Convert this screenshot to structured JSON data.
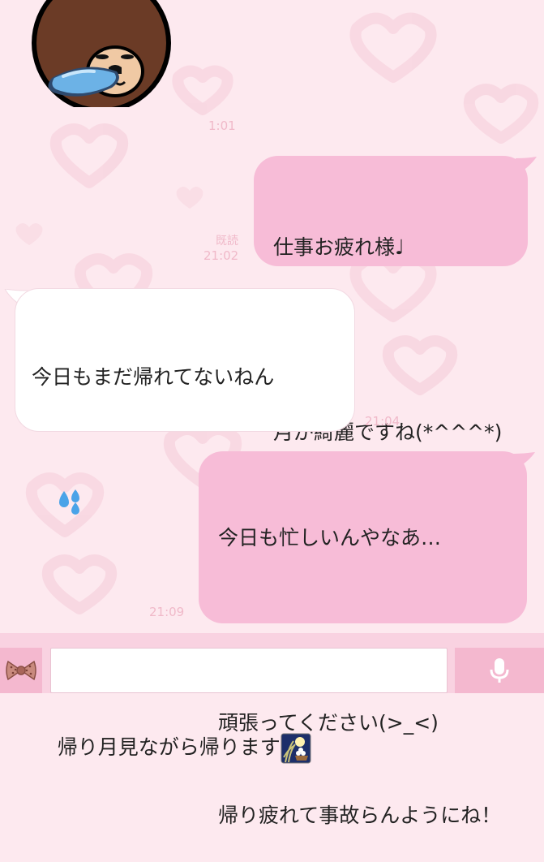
{
  "messages": [
    {
      "id": "m1",
      "direction": "in",
      "type": "sticker",
      "time": "1:01"
    },
    {
      "id": "m2",
      "direction": "out",
      "read": "既読",
      "time": "21:02",
      "lines": [
        "仕事お疲れ様♩",
        "",
        "月が綺麗ですね(*^^^*)"
      ]
    },
    {
      "id": "m3",
      "direction": "in",
      "time": "21:04",
      "lines": [
        "今日もまだ帰れてないねん",
        "",
        "",
        "帰り月見ながら帰ります"
      ],
      "emojis": [
        "sweat-droplets-emoji",
        "moon-viewing-emoji"
      ]
    },
    {
      "id": "m4",
      "direction": "out",
      "time": "21:09",
      "lines": [
        "今日も忙しいんやなあ…",
        "",
        "頑張ってください(>_<)",
        "帰り疲れて事故らんようにね！"
      ]
    }
  ],
  "composer": {
    "placeholder": "",
    "value": ""
  },
  "icons": {
    "ribbon": "ribbon-icon",
    "mic": "microphone-icon"
  },
  "colors": {
    "outgoing": "#f7bcd7",
    "incoming": "#ffffff",
    "background": "#fde9ef",
    "timestamp": "#f0b9c9"
  }
}
